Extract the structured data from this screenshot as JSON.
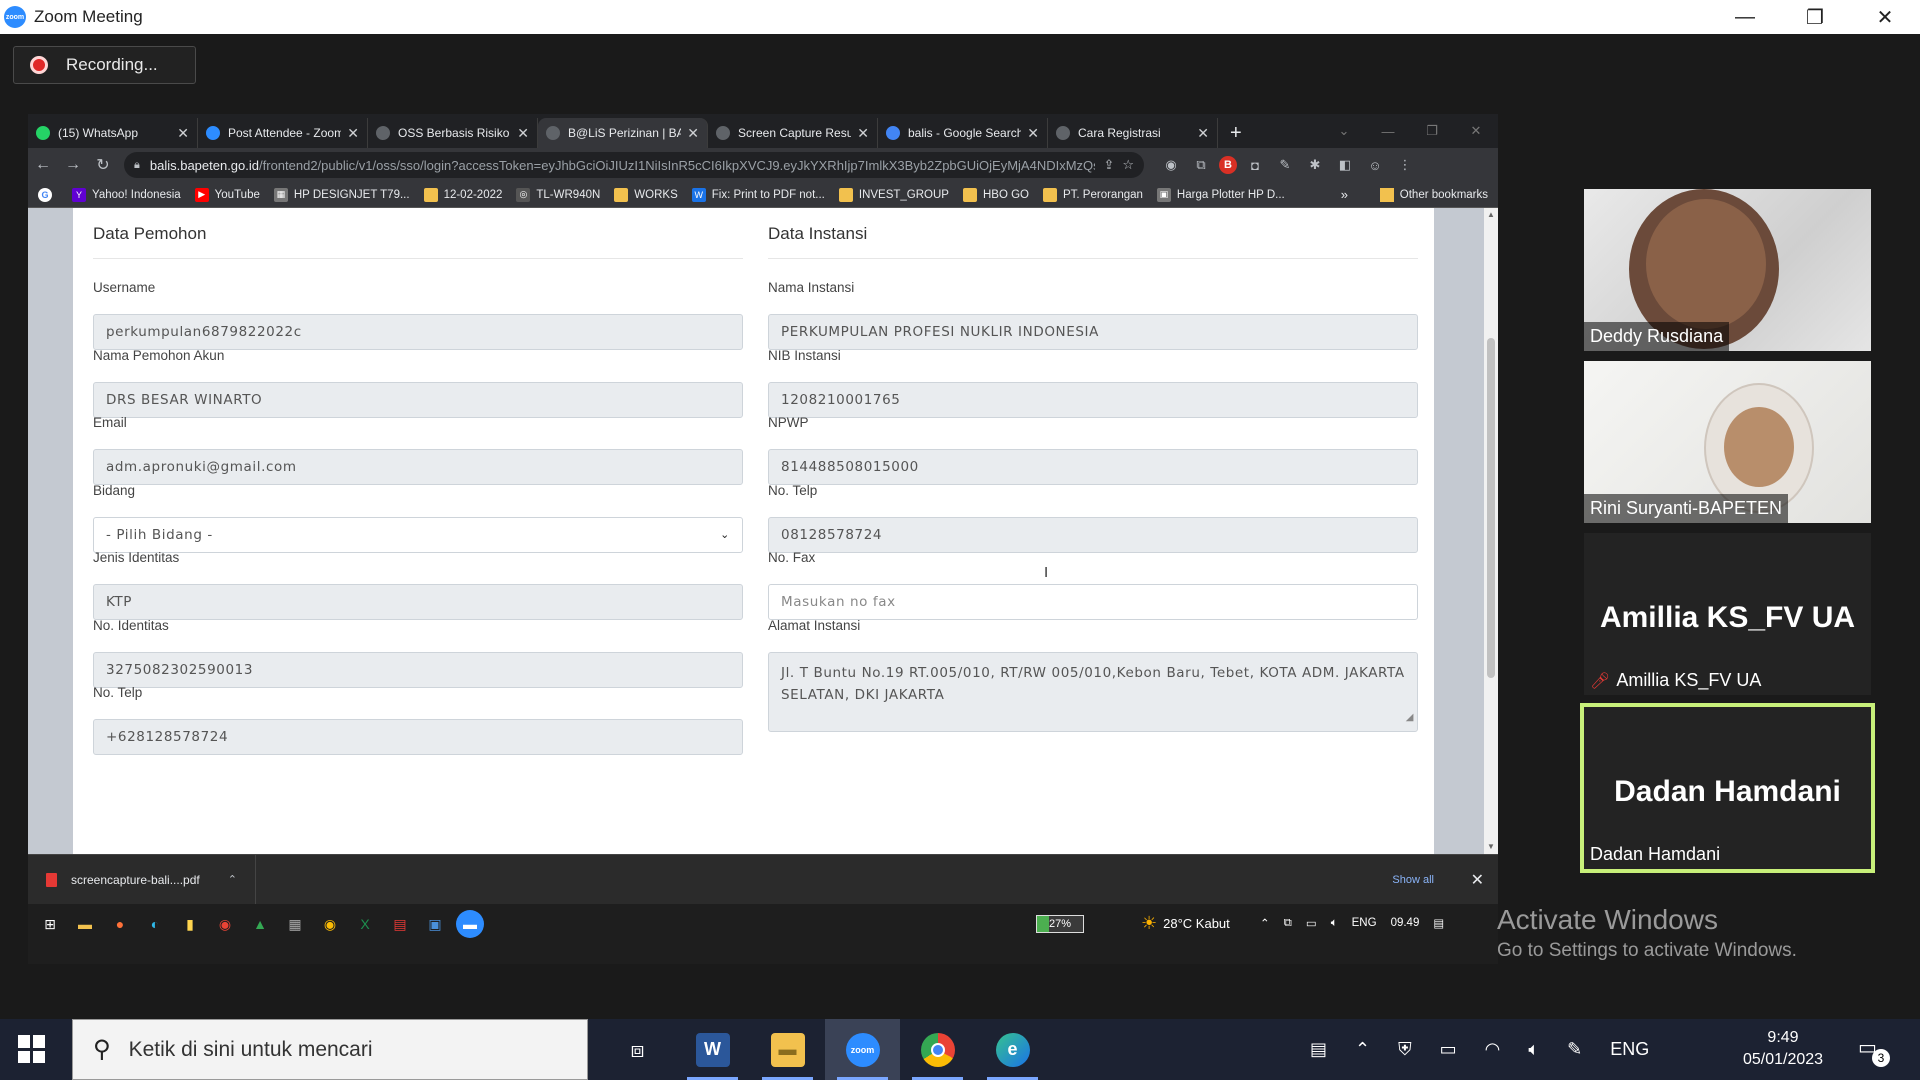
{
  "zoom": {
    "window_title": "Zoom Meeting",
    "logo_text": "zoom",
    "recording_label": "Recording...",
    "win_minimize": "—",
    "win_restore": "❐",
    "win_close": "✕"
  },
  "chrome": {
    "tabs": [
      {
        "label": "(15) WhatsApp",
        "icon": "whatsapp-icon",
        "color": "#25d366"
      },
      {
        "label": "Post Attendee - Zoom",
        "icon": "zoom-icon",
        "color": "#2d8cff"
      },
      {
        "label": "OSS Berbasis Risiko",
        "icon": "globe-icon",
        "color": "#5f6368"
      },
      {
        "label": "B@LiS Perizinan | BAP",
        "icon": "balis-icon",
        "color": "#5f6368",
        "active": true
      },
      {
        "label": "Screen Capture Result",
        "icon": "camera-icon",
        "color": "#5f6368"
      },
      {
        "label": "balis - Google Search",
        "icon": "google-icon",
        "color": "#4285f4"
      },
      {
        "label": "Cara Registrasi",
        "icon": "page-icon",
        "color": "#5f6368"
      }
    ],
    "url_host": "balis.bapeten.go.id",
    "url_rest": "/frontend2/public/v1/oss/sso/login?accessToken=eyJhbGciOiJIUzI1NiIsInR5cCI6IkpXVCJ9.eyJkYXRhIjp7ImlkX3Byb2ZpbGUiOjEyMjA4NDIxMzQsInV...",
    "bookmarks": [
      {
        "label": "Yahoo! Indonesia",
        "icon": "yahoo-icon",
        "color": "#6001d2",
        "glyph": "Y"
      },
      {
        "label": "YouTube",
        "icon": "youtube-icon",
        "color": "#ff0000",
        "glyph": "▶"
      },
      {
        "label": "HP DESIGNJET T79...",
        "icon": "hp-icon",
        "color": "#777777",
        "glyph": "▦"
      },
      {
        "label": "12-02-2022",
        "icon": "folder-icon",
        "color": "#f2c14e",
        "glyph": ""
      },
      {
        "label": "TL-WR940N",
        "icon": "globe-icon",
        "color": "#555555",
        "glyph": "◎"
      },
      {
        "label": "WORKS",
        "icon": "folder-icon",
        "color": "#f2c14e",
        "glyph": ""
      },
      {
        "label": "Fix: Print to PDF not...",
        "icon": "windows-club-icon",
        "color": "#1a73e8",
        "glyph": "W"
      },
      {
        "label": "INVEST_GROUP",
        "icon": "folder-icon",
        "color": "#f2c14e",
        "glyph": ""
      },
      {
        "label": "HBO GO",
        "icon": "folder-icon",
        "color": "#f2c14e",
        "glyph": ""
      },
      {
        "label": "PT. Perorangan",
        "icon": "folder-icon",
        "color": "#f2c14e",
        "glyph": ""
      },
      {
        "label": "Harga Plotter HP D...",
        "icon": "page-icon",
        "color": "#777777",
        "glyph": "▣"
      }
    ],
    "bookmarks_more": "»",
    "other_bookmarks": "Other bookmarks"
  },
  "form": {
    "left_title": "Data Pemohon",
    "right_title": "Data Instansi",
    "left_fields": [
      {
        "label": "Username",
        "value": "perkumpulan6879822022c",
        "type": "readonly"
      },
      {
        "label": "Nama Pemohon Akun",
        "value": "DRS BESAR WINARTO",
        "type": "readonly"
      },
      {
        "label": "Email",
        "value": "adm.apronuki@gmail.com",
        "type": "readonly"
      },
      {
        "label": "Bidang",
        "value": "- Pilih Bidang -",
        "type": "select"
      },
      {
        "label": "Jenis Identitas",
        "value": "KTP",
        "type": "readonly"
      },
      {
        "label": "No. Identitas",
        "value": "3275082302590013",
        "type": "readonly"
      },
      {
        "label": "No. Telp",
        "value": "+628128578724",
        "type": "readonly"
      }
    ],
    "right_fields": [
      {
        "label": "Nama Instansi",
        "value": "PERKUMPULAN PROFESI NUKLIR INDONESIA",
        "type": "readonly"
      },
      {
        "label": "NIB Instansi",
        "value": "1208210001765",
        "type": "readonly"
      },
      {
        "label": "NPWP",
        "value": "814488508015000",
        "type": "readonly"
      },
      {
        "label": "No. Telp",
        "value": "08128578724",
        "type": "readonly"
      },
      {
        "label": "No. Fax",
        "value": "",
        "placeholder": "Masukan no fax",
        "type": "input"
      },
      {
        "label": "Alamat Instansi",
        "value": "Jl. T Buntu No.19 RT.005/010, RT/RW 005/010,Kebon Baru, Tebet, KOTA ADM. JAKARTA SELATAN, DKI JAKARTA",
        "type": "textarea"
      }
    ]
  },
  "download_bar": {
    "file": "screencapture-bali....pdf",
    "show_all": "Show all"
  },
  "remote_taskbar": {
    "battery": "27%",
    "battery_level": 0.27,
    "weather": "28°C  Kabut",
    "lang": "ENG",
    "time": "09.49"
  },
  "activate_windows": {
    "title": "Activate Windows",
    "subtitle": "Go to Settings to activate Windows."
  },
  "participants": [
    {
      "name": "Deddy Rusdiana",
      "video": true
    },
    {
      "name": "Rini Suryanti-BAPETEN",
      "video": true
    },
    {
      "name": "Amillia KS_FV UA",
      "video": false,
      "muted": true
    },
    {
      "name": "Dadan Hamdani",
      "video": false,
      "speaking": true
    }
  ],
  "host_taskbar": {
    "search_placeholder": "Ketik di sini untuk mencari",
    "lang": "ENG",
    "time": "9:49",
    "date": "05/01/2023",
    "notif_count": "3"
  }
}
